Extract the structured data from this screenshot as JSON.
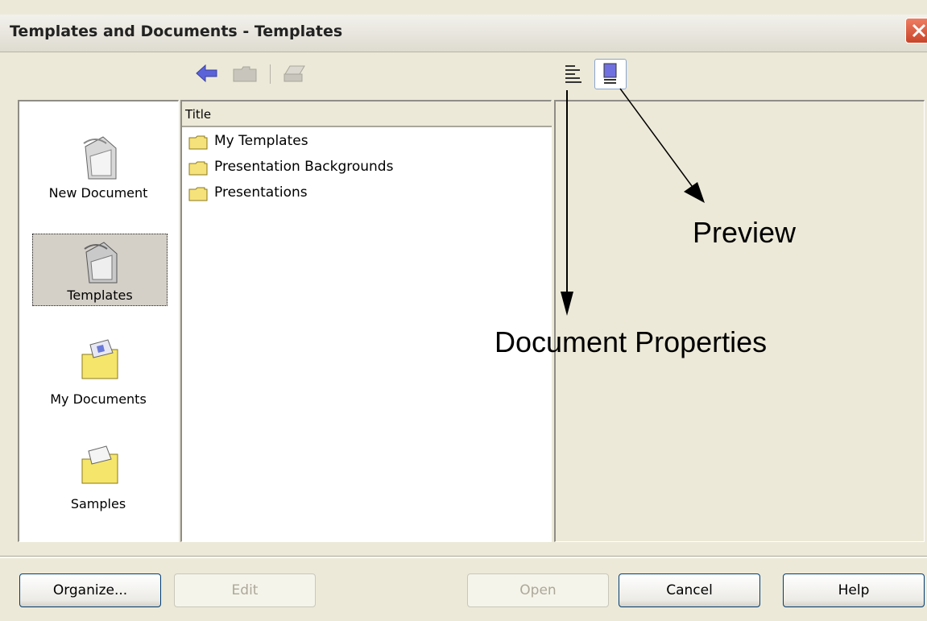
{
  "window": {
    "title": "Templates and Documents - Templates"
  },
  "toolbar": {
    "back_icon": "back-arrow-icon",
    "up_icon": "folder-up-icon",
    "print_icon": "print-icon",
    "doc_properties_icon": "document-properties-icon",
    "preview_icon": "preview-icon"
  },
  "places": [
    {
      "label": "New Document",
      "mnemonic": "N",
      "icon": "new-document-icon",
      "selected": false
    },
    {
      "label": "Templates",
      "mnemonic": "T",
      "icon": "templates-icon",
      "selected": true
    },
    {
      "label": "My Documents",
      "mnemonic": "M",
      "icon": "my-documents-icon",
      "selected": false
    },
    {
      "label": "Samples",
      "mnemonic": "S",
      "icon": "samples-icon",
      "selected": false
    }
  ],
  "list": {
    "column_header": "Title",
    "items": [
      "My Templates",
      "Presentation Backgrounds",
      "Presentations"
    ]
  },
  "annotations": {
    "preview": "Preview",
    "document_properties": "Document Properties"
  },
  "buttons": {
    "organize": "Organize...",
    "edit": "Edit",
    "open": "Open",
    "cancel": "Cancel",
    "help": "Help"
  }
}
